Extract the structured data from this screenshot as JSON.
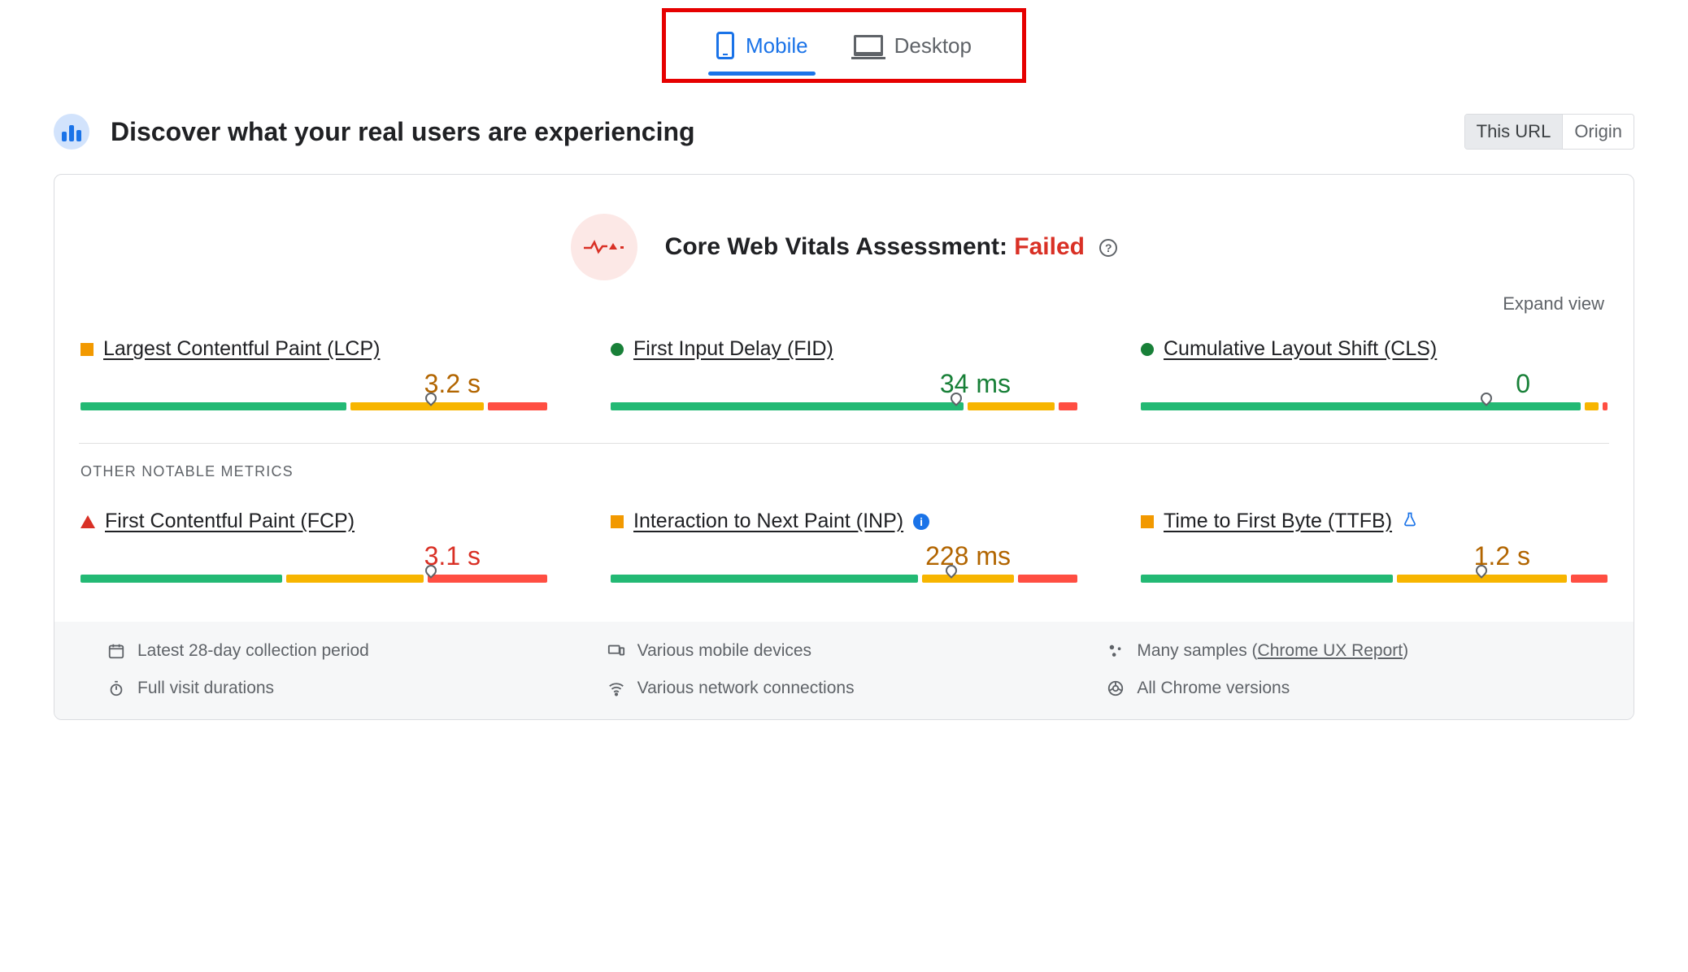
{
  "tabs": {
    "mobile": "Mobile",
    "desktop": "Desktop"
  },
  "page_title": "Discover what your real users are experiencing",
  "toggle": {
    "this_url": "This URL",
    "origin": "Origin"
  },
  "assessment": {
    "label": "Core Web Vitals Assessment: ",
    "status": "Failed"
  },
  "expand": "Expand view",
  "section_other": "OTHER NOTABLE METRICS",
  "metrics": {
    "lcp": {
      "name": "Largest Contentful Paint (LCP)",
      "value": "3.2 s"
    },
    "fid": {
      "name": "First Input Delay (FID)",
      "value": "34 ms"
    },
    "cls": {
      "name": "Cumulative Layout Shift (CLS)",
      "value": "0"
    },
    "fcp": {
      "name": "First Contentful Paint (FCP)",
      "value": "3.1 s"
    },
    "inp": {
      "name": "Interaction to Next Paint (INP)",
      "value": "228 ms"
    },
    "ttfb": {
      "name": "Time to First Byte (TTFB)",
      "value": "1.2 s"
    }
  },
  "info": {
    "period": "Latest 28-day collection period",
    "devices": "Various mobile devices",
    "samples_prefix": "Many samples (",
    "samples_link": "Chrome UX Report",
    "samples_suffix": ")",
    "durations": "Full visit durations",
    "network": "Various network connections",
    "versions": "All Chrome versions"
  },
  "colors": {
    "green": "#188038",
    "orange": "#f29900",
    "red": "#d93025",
    "blue": "#1a73e8"
  }
}
